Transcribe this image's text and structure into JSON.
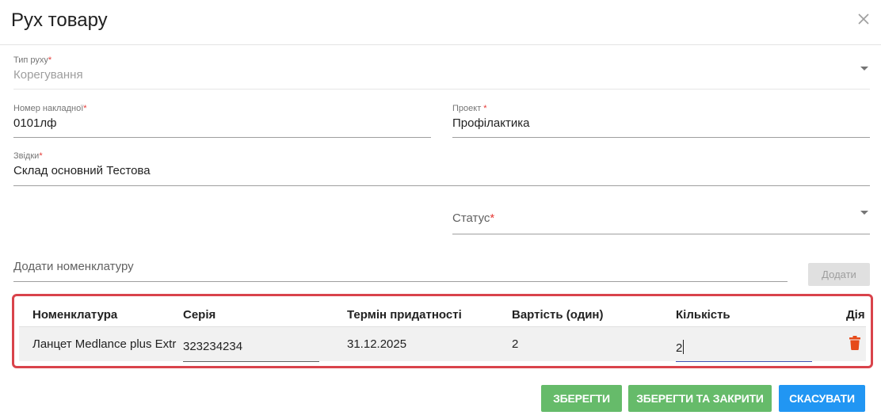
{
  "dialog": {
    "title": "Рух товару"
  },
  "form": {
    "movement_type": {
      "label": "Тип руху",
      "value": "Корегування"
    },
    "invoice_number": {
      "label": "Номер накладної",
      "value": "0101лф"
    },
    "project": {
      "label": "Проект ",
      "value": "Профілактика"
    },
    "from": {
      "label": "Звідки",
      "value": "Склад основний Тестова"
    },
    "status": {
      "label": "Статус",
      "value": ""
    },
    "add_nomenclature": {
      "placeholder": "Додати номенклатуру",
      "button": "Додати"
    },
    "required_mark": "*"
  },
  "table": {
    "headers": [
      "Номенклатура",
      "Серія",
      "Термін придатності",
      "Вартість (один)",
      "Кількість",
      "Дія"
    ],
    "rows": [
      {
        "name": "Ланцет Medlance plus Extra",
        "series": "323234234",
        "expiry": "31.12.2025",
        "cost": "2",
        "quantity": "2"
      }
    ]
  },
  "actions": {
    "save": "ЗБЕРЕГТИ",
    "save_close": "ЗБЕРЕГТИ ТА ЗАКРИТИ",
    "cancel": "СКАСУВАТИ"
  },
  "icons": {
    "close": "close-icon",
    "dropdown": "chevron-down-icon",
    "delete": "trash-icon"
  },
  "colors": {
    "danger": "#d9434b",
    "green": "#66bb6a",
    "blue": "#2196f3",
    "trash": "#e64a19"
  }
}
